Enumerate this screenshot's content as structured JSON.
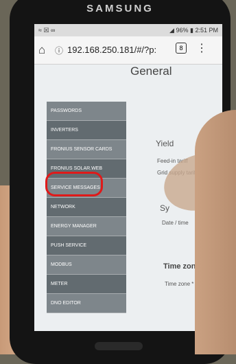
{
  "phone": {
    "brand": "SAMSUNG"
  },
  "status_bar": {
    "left_icons": "≈ ☒ ∞",
    "battery": "96%",
    "time": "2:51 PM"
  },
  "browser": {
    "url": "192.168.250.181/#/?p:",
    "tab_count": "8"
  },
  "page": {
    "heading": "General",
    "yield_title": "Yield",
    "feed_in": "Feed-in tariff",
    "grid_supply": "Grid supply tariff",
    "sy": "Sy",
    "date_time": "Date / time",
    "timezone_title": "Time zone se",
    "timezone_label": "Time zone *"
  },
  "sidebar": {
    "items": [
      {
        "label": "PASSWORDS"
      },
      {
        "label": "INVERTERS"
      },
      {
        "label": "FRONIUS SENSOR CARDS"
      },
      {
        "label": "FRONIUS SOLAR.WEB"
      },
      {
        "label": "SERVICE MESSAGES"
      },
      {
        "label": "NETWORK"
      },
      {
        "label": "ENERGY MANAGER"
      },
      {
        "label": "PUSH SERVICE"
      },
      {
        "label": "MODBUS"
      },
      {
        "label": "METER"
      },
      {
        "label": "DNO EDITOR"
      }
    ]
  },
  "colors": {
    "highlight": "#e01919",
    "sidebar": "#7e868b"
  }
}
